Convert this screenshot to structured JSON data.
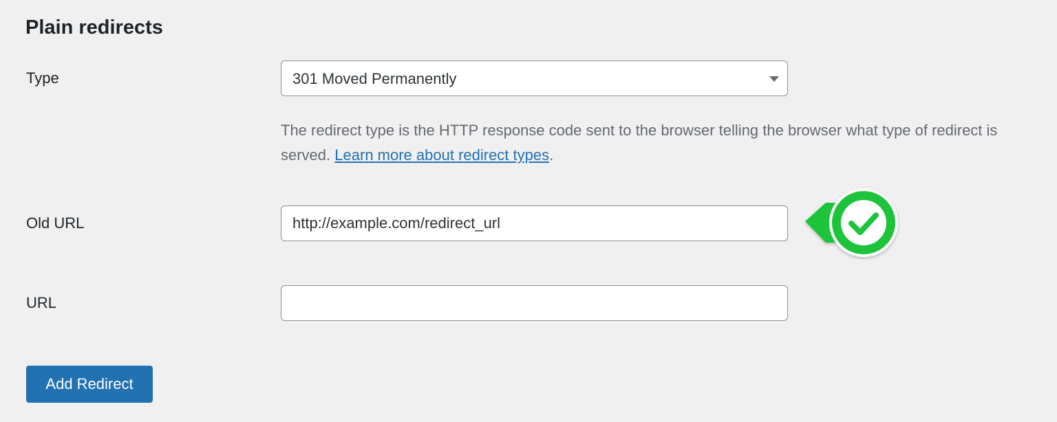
{
  "section": {
    "title": "Plain redirects"
  },
  "type_field": {
    "label": "Type",
    "selected": "301 Moved Permanently",
    "description": "The redirect type is the HTTP response code sent to the browser telling the browser what type of redirect is served.",
    "link_text": "Learn more about redirect types",
    "after_link": "."
  },
  "old_url_field": {
    "label": "Old URL",
    "value": "http://example.com/redirect_url",
    "status_icon": "check-circle-icon"
  },
  "url_field": {
    "label": "URL",
    "value": ""
  },
  "actions": {
    "add_label": "Add Redirect"
  },
  "colors": {
    "background": "#f0f0f1",
    "primary_button": "#2271b1",
    "link": "#2271b1",
    "success": "#1ec33b",
    "description_text": "#646970"
  }
}
